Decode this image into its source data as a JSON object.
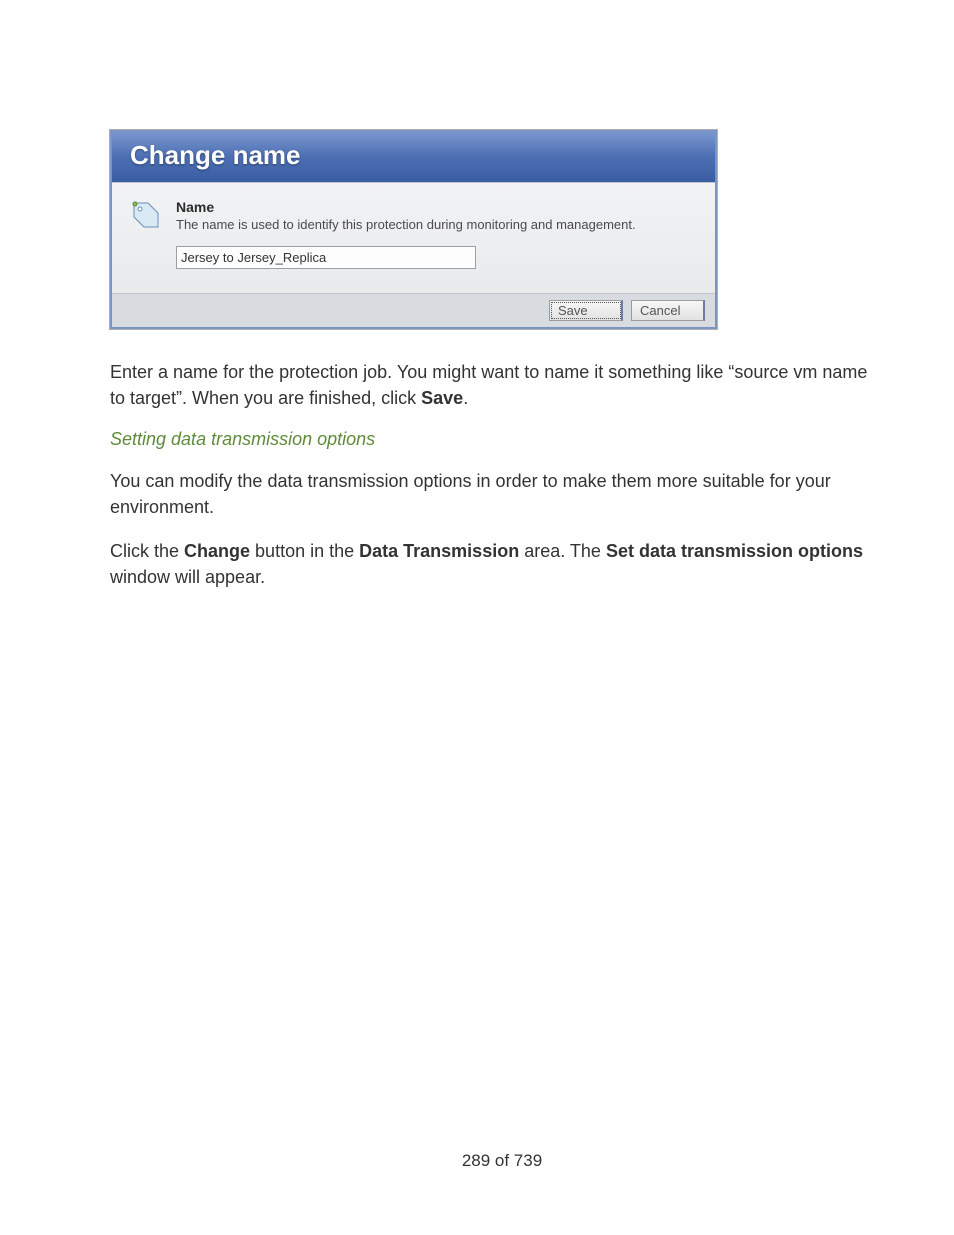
{
  "dialog": {
    "title": "Change name",
    "field_label": "Name",
    "field_desc": "The name is used to identify this protection during monitoring and management.",
    "input_value": "Jersey to Jersey_Replica",
    "save_label": "Save",
    "cancel_label": "Cancel"
  },
  "doc": {
    "para1_a": "Enter a name for the protection job. You might want to name it something like “source vm name to target”. When you are finished, click ",
    "para1_b_bold": "Save",
    "para1_c": ".",
    "heading": "Setting data transmission options",
    "para2": "You can modify the data transmission options in order to make them more suitable for your environment.",
    "para3_a": "Click the ",
    "para3_b_bold": "Change",
    "para3_c": " button in the ",
    "para3_d_bold": "Data Transmission",
    "para3_e": " area. The ",
    "para3_f_bold": "Set data transmission options",
    "para3_g": " window will appear.",
    "page_number": "289 of 739"
  }
}
